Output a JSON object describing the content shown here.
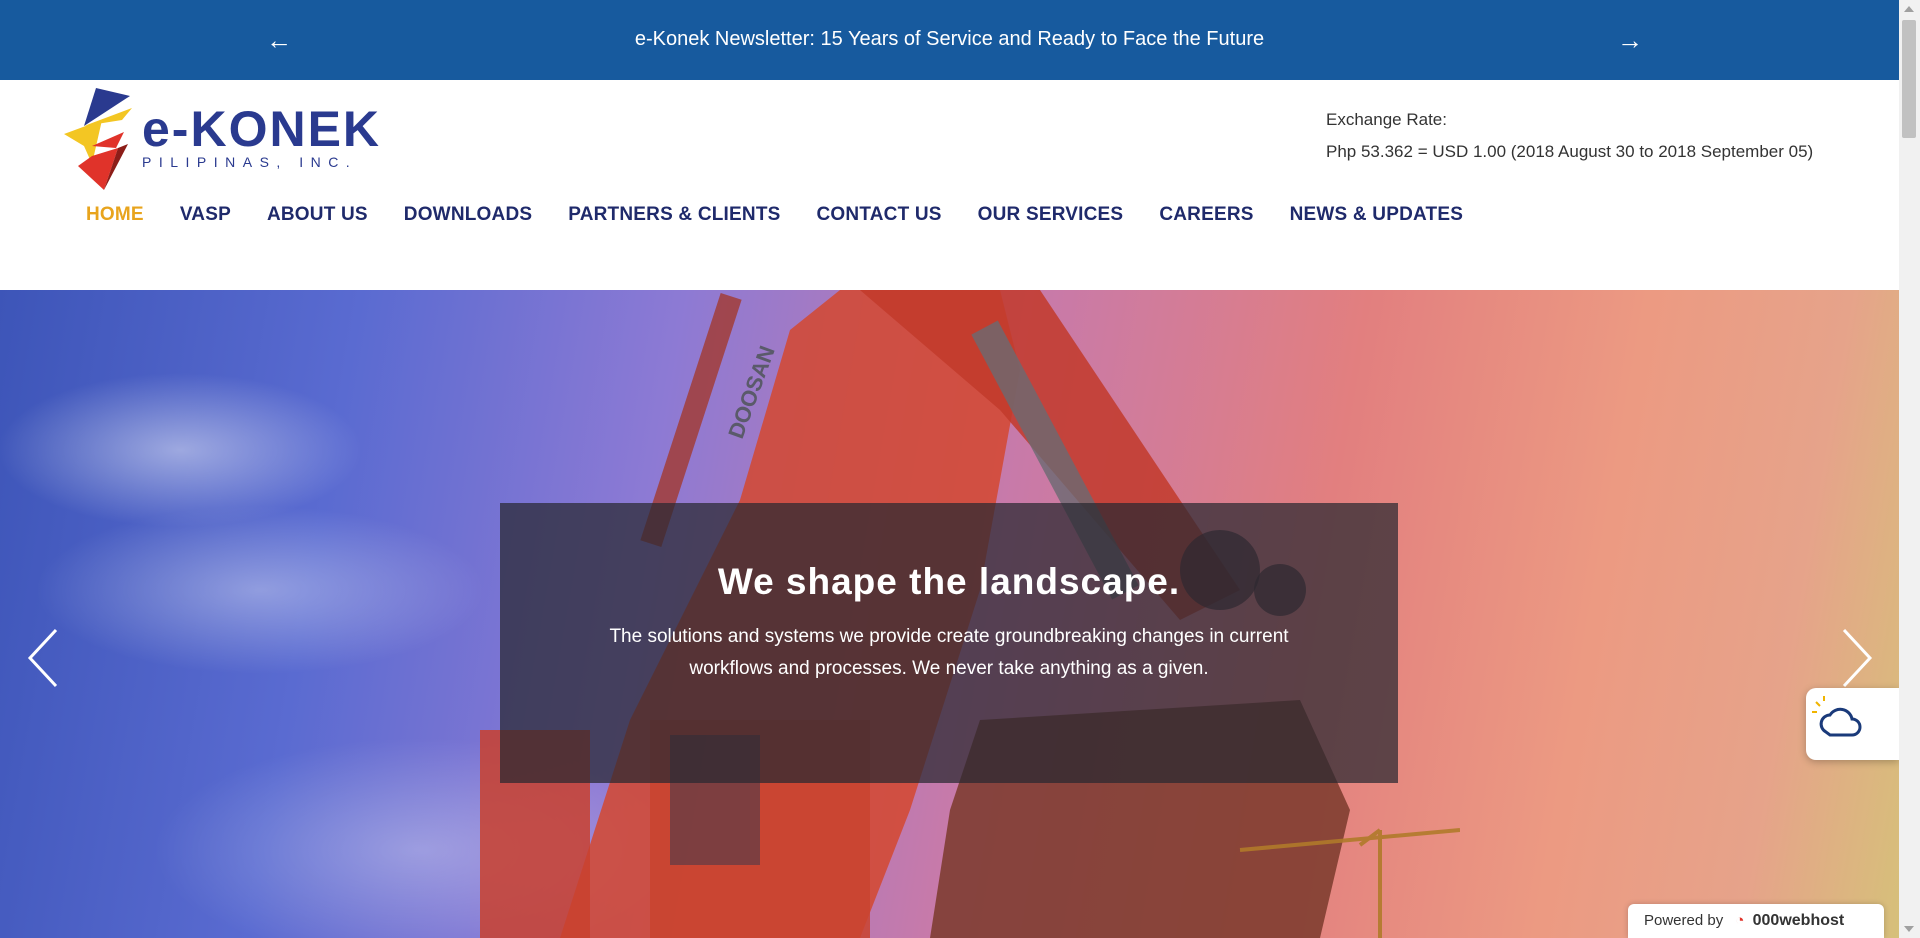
{
  "announcement": {
    "prev_icon": "←",
    "next_icon": "→",
    "headline": "e-Konek Newsletter: 15 Years of Service and Ready to Face the Future",
    "bg_color": "#175a9e"
  },
  "logo": {
    "brand": "e-KONEK",
    "tagline": "PILIPINAS, INC."
  },
  "exchange": {
    "label": "Exchange Rate:",
    "value": "Php 53.362 = USD 1.00 (2018 August 30 to 2018 September 05)"
  },
  "nav": {
    "items": [
      {
        "label": "HOME",
        "active": true
      },
      {
        "label": "VASP"
      },
      {
        "label": "ABOUT US"
      },
      {
        "label": "DOWNLOADS"
      },
      {
        "label": "PARTNERS & CLIENTS"
      },
      {
        "label": "CONTACT US"
      },
      {
        "label": "OUR SERVICES"
      },
      {
        "label": "CAREERS"
      },
      {
        "label": "NEWS & UPDATES"
      }
    ],
    "active_color": "#e8a41d",
    "color": "#1f2a6b"
  },
  "hero": {
    "title": "We shape the landscape.",
    "text": "The solutions and systems we provide create groundbreaking changes in current workflows and processes. We never take anything as a given.",
    "excavator_label": "DOOSAN"
  },
  "footer_badge": {
    "prefix": "Powered by",
    "brand": "000webhost"
  }
}
